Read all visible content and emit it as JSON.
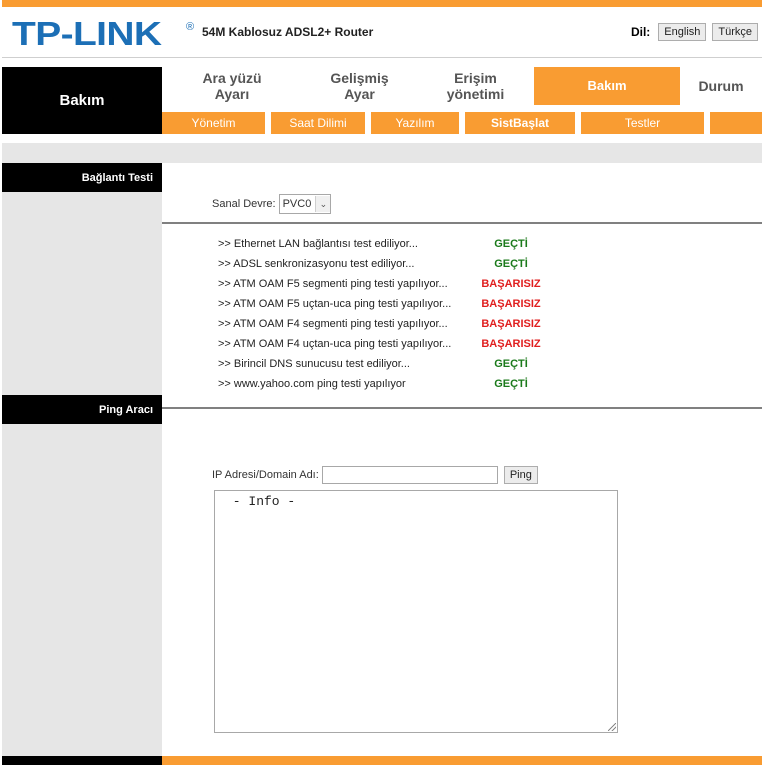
{
  "header": {
    "logo": "TP-LINK",
    "logo_mark": "®",
    "product": "54M Kablosuz ADSL2+ Router",
    "lang_label": "Dil:",
    "lang_buttons": [
      "English",
      "Türkçe"
    ]
  },
  "nav": {
    "section_title": "Bakım",
    "tabs": [
      {
        "label_line1": "Ara yüzü",
        "label_line2": "Ayarı",
        "active": false
      },
      {
        "label_line1": "Gelişmiş",
        "label_line2": "Ayar",
        "active": false
      },
      {
        "label_line1": "Erişim",
        "label_line2": "yönetimi",
        "active": false
      },
      {
        "label_line1": "Bakım",
        "label_line2": "",
        "active": true
      },
      {
        "label_line1": "Durum",
        "label_line2": "",
        "active": false
      }
    ],
    "subtabs": [
      {
        "label": "Yönetim",
        "active": false
      },
      {
        "label": "Saat Dilimi",
        "active": false
      },
      {
        "label": "Yazılım",
        "active": false
      },
      {
        "label": "SistBaşlat",
        "active": true
      },
      {
        "label": "Testler",
        "active": false
      }
    ]
  },
  "connection_test": {
    "heading": "Bağlantı Testi",
    "pvc_label": "Sanal Devre:",
    "pvc_value": "PVC0",
    "results": [
      {
        "label": ">> Ethernet LAN bağlantısı test ediliyor...",
        "result": "GEÇTİ",
        "status": "pass"
      },
      {
        "label": ">> ADSL senkronizasyonu test ediliyor...",
        "result": "GEÇTİ",
        "status": "pass"
      },
      {
        "label": ">> ATM OAM F5 segmenti ping testi yapılıyor...",
        "result": "BAŞARISIZ",
        "status": "fail"
      },
      {
        "label": ">> ATM OAM F5 uçtan-uca ping testi yapılıyor...",
        "result": "BAŞARISIZ",
        "status": "fail"
      },
      {
        "label": ">> ATM OAM F4 segmenti ping testi yapılıyor...",
        "result": "BAŞARISIZ",
        "status": "fail"
      },
      {
        "label": ">> ATM OAM F4 uçtan-uca ping testi yapılıyor...",
        "result": "BAŞARISIZ",
        "status": "fail"
      },
      {
        "label": ">> Birincil DNS sunucusu test ediliyor...",
        "result": "GEÇTİ",
        "status": "pass"
      },
      {
        "label": ">> www.yahoo.com ping testi yapılıyor",
        "result": "GEÇTİ",
        "status": "pass"
      }
    ]
  },
  "ping_tool": {
    "heading": "Ping Aracı",
    "ip_label": "IP Adresi/Domain Adı:",
    "ip_value": "",
    "ping_button": "Ping",
    "info_text": " - Info -"
  },
  "colors": {
    "accent": "#f99c32",
    "brand": "#1c6fb6",
    "pass": "#1b7a1b",
    "fail": "#e01e1e"
  }
}
